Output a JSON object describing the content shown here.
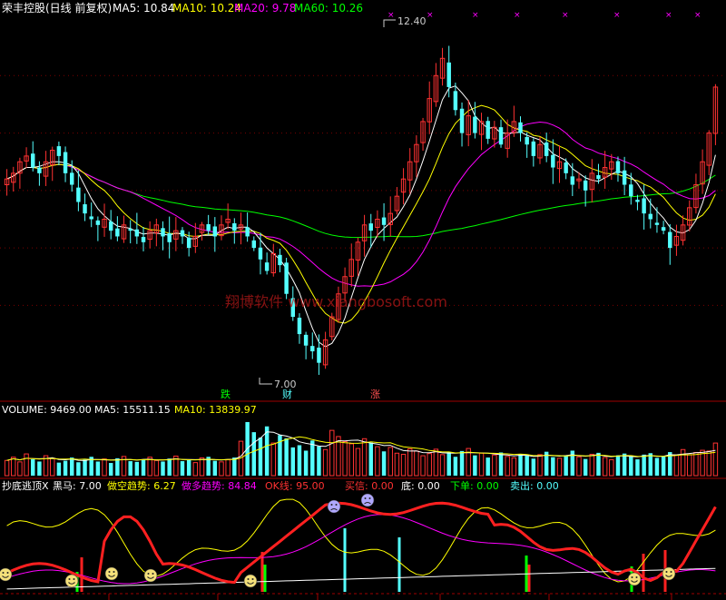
{
  "main_panel": {
    "stock_name": "荣丰控股(日线 前复权)",
    "ma5_label": "MA5: 10.84",
    "ma10_label": "MA10: 10.24",
    "ma20_label": "MA20: 9.78",
    "ma60_label": "MA60: 10.26",
    "high_label": "12.40",
    "low_label": "7.00",
    "watermark": "翔博软件 www.xiangbosoft.com",
    "annotation_die": "跌",
    "annotation_cai": "财",
    "annotation_zhang": "涨"
  },
  "volume_panel": {
    "volume_label": "VOLUME: 9469.00",
    "ma5_label": "MA5: 15511.15",
    "ma10_label": "MA10: 13839.97"
  },
  "indicator_panel": {
    "name_label": "抄底逃顶X",
    "heima_label": "黑马: 7.00",
    "zuokong_label": "做空趋势: 6.27",
    "zuoduo_label": "做多趋势: 84.84",
    "ok_label": "OK线: 95.00",
    "maixin_label": "买信: 0.00",
    "di_label": "底: 0.00",
    "xiadan_label": "下单: 0.00",
    "maichu_label": "卖出: 0.00"
  },
  "colors": {
    "up": "#ff3232",
    "down": "#54ffff",
    "ma5": "#ffffff",
    "ma10": "#ffff00",
    "ma20": "#ff00ff",
    "ma60": "#00ff00",
    "frame": "#a00000"
  },
  "chart_data": [
    {
      "type": "candlestick",
      "title": "荣丰控股(日线 前复权)",
      "price_range": [
        6.6,
        13.0
      ],
      "annotations": {
        "high": 12.4,
        "low": 7.0
      },
      "series": [
        {
          "name": "MA5",
          "last": 10.84
        },
        {
          "name": "MA10",
          "last": 10.24
        },
        {
          "name": "MA20",
          "last": 9.78
        },
        {
          "name": "MA60",
          "last": 10.26
        }
      ],
      "close": [
        10.2,
        10.3,
        10.5,
        10.6,
        10.4,
        10.3,
        10.5,
        10.7,
        10.6,
        10.3,
        10.1,
        9.8,
        9.6,
        9.5,
        9.4,
        9.5,
        9.3,
        9.2,
        9.4,
        9.3,
        9.2,
        9.1,
        9.3,
        9.4,
        9.2,
        9.1,
        9.3,
        9.2,
        9.0,
        9.2,
        9.4,
        9.3,
        9.2,
        9.4,
        9.5,
        9.3,
        9.4,
        9.2,
        9.0,
        8.8,
        8.6,
        8.9,
        8.7,
        8.2,
        7.8,
        7.5,
        7.3,
        7.2,
        7.0,
        7.4,
        7.8,
        8.2,
        8.5,
        8.8,
        9.1,
        9.4,
        9.3,
        9.5,
        9.4,
        9.6,
        9.9,
        10.2,
        10.5,
        10.8,
        11.2,
        11.6,
        12.0,
        12.3,
        11.8,
        11.4,
        11.0,
        11.3,
        11.0,
        11.2,
        10.9,
        11.1,
        10.8,
        11.0,
        11.2,
        11.0,
        10.8,
        10.6,
        10.8,
        10.6,
        10.4,
        10.5,
        10.3,
        10.1,
        10.2,
        10.0,
        10.3,
        10.2,
        10.4,
        10.5,
        10.3,
        10.1,
        9.9,
        9.8,
        9.6,
        9.5,
        9.4,
        9.3,
        9.0,
        9.2,
        9.4,
        9.7,
        10.1,
        10.5,
        11.0,
        11.8
      ]
    },
    {
      "type": "bar",
      "title": "VOLUME",
      "series": [
        {
          "name": "VOLUME",
          "last": 9469.0
        },
        {
          "name": "MA5",
          "last": 15511.15
        },
        {
          "name": "MA10",
          "last": 13839.97
        }
      ],
      "values": [
        4.2,
        5.1,
        3.8,
        6.0,
        4.5,
        3.9,
        5.5,
        4.8,
        3.6,
        4.1,
        5.0,
        3.7,
        4.4,
        5.2,
        3.9,
        4.6,
        3.5,
        4.8,
        5.3,
        4.0,
        3.8,
        4.5,
        5.1,
        4.2,
        3.9,
        4.7,
        5.4,
        4.0,
        4.3,
        3.6,
        4.9,
        5.2,
        4.1,
        3.8,
        4.4,
        5.0,
        9.5,
        14.8,
        12.0,
        10.5,
        13.6,
        9.0,
        11.2,
        10.3,
        7.8,
        8.4,
        6.9,
        9.7,
        8.1,
        7.2,
        12.5,
        10.8,
        9.4,
        8.8,
        7.5,
        10.2,
        9.1,
        8.0,
        6.7,
        7.8,
        6.2,
        5.9,
        7.4,
        6.8,
        5.5,
        6.1,
        7.3,
        5.8,
        6.5,
        5.2,
        6.8,
        7.5,
        5.6,
        6.2,
        5.0,
        5.7,
        6.4,
        5.3,
        4.9,
        6.0,
        5.5,
        4.7,
        5.8,
        6.6,
        5.1,
        4.8,
        5.4,
        6.9,
        5.2,
        4.6,
        5.9,
        6.3,
        5.0,
        4.4,
        5.6,
        6.1,
        5.3,
        4.5,
        5.8,
        6.2,
        4.9,
        5.4,
        6.5,
        5.7,
        7.2,
        5.8,
        6.4,
        7.0,
        6.8,
        9.0
      ]
    }
  ]
}
